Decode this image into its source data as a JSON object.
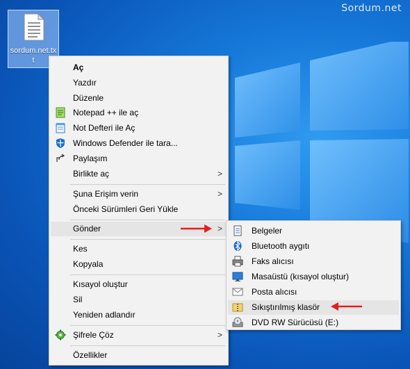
{
  "watermark": "Sordum.net",
  "desktop_icon": {
    "name": "sordum.net.txt"
  },
  "context_menu": {
    "items": [
      {
        "label": "Aç"
      },
      {
        "label": "Yazdır"
      },
      {
        "label": "Düzenle"
      },
      {
        "label": "Notepad ++ ile aç"
      },
      {
        "label": "Not Defteri ile Aç"
      },
      {
        "label": "Windows Defender ile tara..."
      },
      {
        "label": "Paylaşım"
      },
      {
        "label": "Birlikte aç"
      },
      {
        "label": "Şuna Erişim verin"
      },
      {
        "label": "Önceki Sürümleri Geri Yükle"
      },
      {
        "label": "Gönder"
      },
      {
        "label": "Kes"
      },
      {
        "label": "Kopyala"
      },
      {
        "label": "Kısayol oluştur"
      },
      {
        "label": "Sil"
      },
      {
        "label": "Yeniden adlandır"
      },
      {
        "label": "Şifrele  Çöz"
      },
      {
        "label": "Özellikler"
      }
    ],
    "submenu_arrow": ">"
  },
  "send_to_menu": {
    "items": [
      {
        "label": "Belgeler"
      },
      {
        "label": "Bluetooth aygıtı"
      },
      {
        "label": "Faks alıcısı"
      },
      {
        "label": "Masaüstü (kısayol oluştur)"
      },
      {
        "label": "Posta alıcısı"
      },
      {
        "label": "Sıkıştırılmış klasör"
      },
      {
        "label": "DVD RW Sürücüsü (E:)"
      }
    ]
  },
  "colors": {
    "desktop_blue": "#0a55b8",
    "menu_bg": "#f2f2f2",
    "highlight": "#e5e5e5",
    "annotation_red": "#e02020"
  }
}
